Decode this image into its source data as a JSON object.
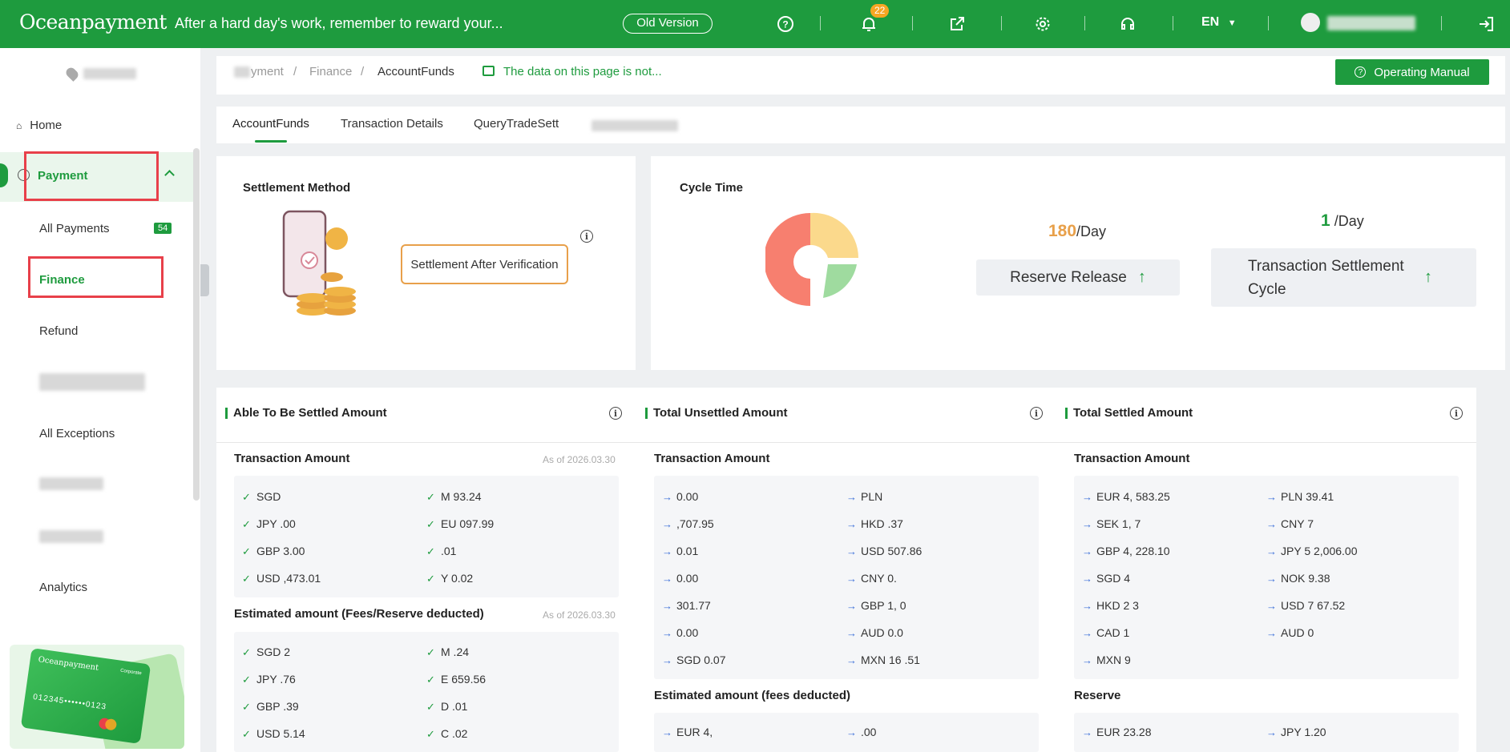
{
  "header": {
    "logo": "Oceanpayment",
    "slogan": "After a hard day's work, remember to reward your...",
    "old_version": "Old Version",
    "notification_count": "22",
    "language": "EN"
  },
  "sidebar": {
    "home": "Home",
    "payment": "Payment",
    "all_payments": "All Payments",
    "all_payments_count": "54",
    "finance": "Finance",
    "refund": "Refund",
    "all_exceptions": "All Exceptions",
    "analytics": "Analytics",
    "promo_card_brand": "Oceanpayment",
    "promo_card_number": "012345••••••0123",
    "promo_card_label": "Corporate"
  },
  "breadcrumb": {
    "first": "yment",
    "second": "Finance",
    "current": "AccountFunds",
    "notice": "The data on this page is not...",
    "manual": "Operating Manual"
  },
  "tabs": [
    "AccountFunds",
    "Transaction Details",
    "QueryTradeSett"
  ],
  "settlement": {
    "title": "Settlement Method",
    "method": "Settlement After Verification"
  },
  "cycle": {
    "title": "Cycle Time",
    "reserve_value": "180",
    "reserve_unit": "/Day",
    "reserve_label": "Reserve Release",
    "settle_value": "1",
    "settle_unit": " /Day",
    "settle_label": "Transaction Settlement Cycle"
  },
  "able": {
    "title": "Able To Be Settled Amount",
    "transaction_title": "Transaction Amount",
    "asof1": "As of 2026.03.30",
    "txn_left": [
      "SGD",
      "JPY .00",
      "GBP 3.00",
      "USD ,473.01"
    ],
    "txn_right": [
      "M 93.24",
      "EU 097.99",
      ".01",
      "Y 0.02"
    ],
    "estimated_title": "Estimated amount (Fees/Reserve deducted)",
    "asof2": "As of 2026.03.30",
    "est_left": [
      "SGD 2",
      "JPY .76",
      "GBP .39",
      "USD 5.14"
    ],
    "est_right": [
      "M .24",
      "E 659.56",
      "D .01",
      "C .02"
    ]
  },
  "unsettled": {
    "title": "Total Unsettled Amount",
    "transaction_title": "Transaction Amount",
    "txn_left": [
      "0.00",
      ",707.95",
      "0.01",
      "0.00",
      "301.77",
      "0.00",
      "SGD 0.07"
    ],
    "txn_right": [
      "PLN",
      "HKD .37",
      "USD 507.86",
      "CNY 0.",
      "GBP 1, 0",
      "AUD 0.0",
      "MXN 16 .51"
    ],
    "estimated_title": "Estimated amount (fees deducted)",
    "est_left": [
      "EUR 4,"
    ],
    "est_right": [
      ".00"
    ]
  },
  "settled": {
    "title": "Total Settled Amount",
    "transaction_title": "Transaction Amount",
    "txn_left": [
      "EUR 4, 583.25",
      "SEK 1, 7",
      "GBP 4, 228.10",
      "SGD 4",
      "HKD 2 3",
      "CAD 1",
      "MXN 9"
    ],
    "txn_right": [
      "PLN 39.41",
      "CNY 7",
      "JPY 5 2,006.00",
      "NOK 9.38",
      "USD 7 67.52",
      "AUD 0"
    ],
    "reserve_title": "Reserve",
    "reserve_left": [
      "EUR 23.28"
    ],
    "reserve_right": [
      "JPY 1.20"
    ]
  },
  "colors": {
    "brand": "#1e9b3e",
    "highlight": "#e8404a",
    "accent": "#e8a04a"
  }
}
